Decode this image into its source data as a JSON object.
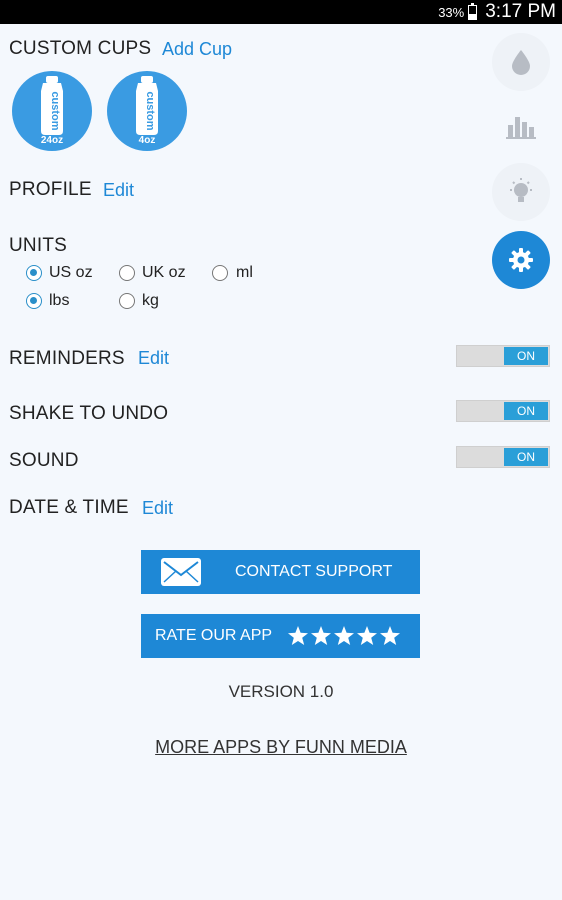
{
  "status_bar": {
    "battery": "33%",
    "time": "3:17 PM"
  },
  "custom_cups": {
    "title": "CUSTOM CUPS",
    "add_label": "Add Cup",
    "cups": [
      {
        "label": "custom",
        "size": "24oz"
      },
      {
        "label": "custom",
        "size": "4oz"
      }
    ]
  },
  "profile": {
    "title": "PROFILE",
    "edit": "Edit"
  },
  "units": {
    "title": "UNITS",
    "volume_options": [
      {
        "label": "US oz",
        "selected": true
      },
      {
        "label": "UK oz",
        "selected": false
      },
      {
        "label": "ml",
        "selected": false
      }
    ],
    "weight_options": [
      {
        "label": "lbs",
        "selected": true
      },
      {
        "label": "kg",
        "selected": false
      }
    ]
  },
  "reminders": {
    "title": "REMINDERS",
    "edit": "Edit",
    "toggle": "ON"
  },
  "shake_to_undo": {
    "title": "SHAKE TO UNDO",
    "toggle": "ON"
  },
  "sound": {
    "title": "SOUND",
    "toggle": "ON"
  },
  "date_time": {
    "title": "DATE & TIME",
    "edit": "Edit"
  },
  "contact_support": {
    "label": "CONTACT SUPPORT"
  },
  "rate_app": {
    "label": "RATE OUR APP",
    "stars": 5
  },
  "version": "VERSION 1.0",
  "more_apps": "MORE APPS BY FUNN MEDIA",
  "side_nav": [
    {
      "icon": "water-drop-icon",
      "active": false
    },
    {
      "icon": "bar-chart-icon",
      "active": false
    },
    {
      "icon": "lightbulb-icon",
      "active": false
    },
    {
      "icon": "gear-icon",
      "active": true
    }
  ],
  "colors": {
    "accent": "#1e88d6",
    "toggle_on": "#2a9fd8",
    "background": "#f4f8fd"
  }
}
